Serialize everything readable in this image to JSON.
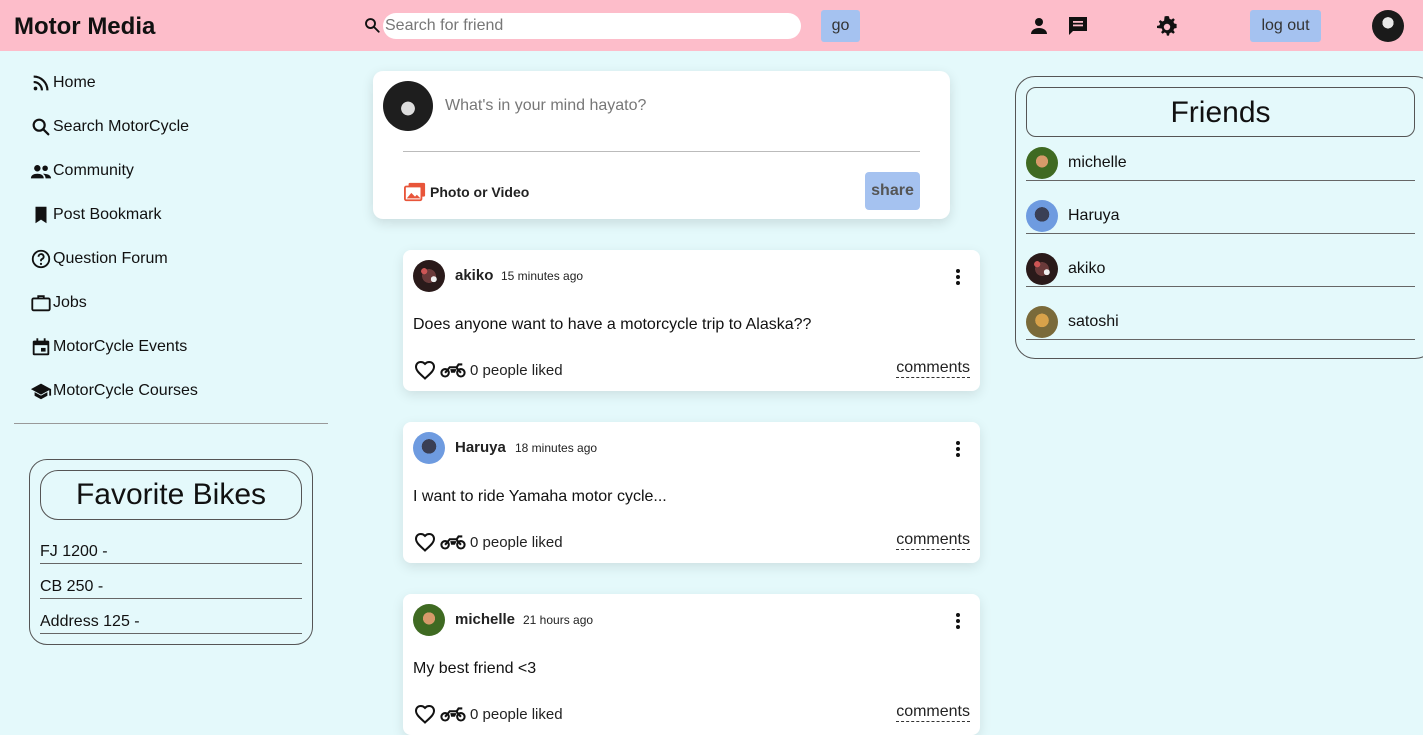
{
  "header": {
    "logo": "Motor Media",
    "search_placeholder": "Search for friend",
    "go_label": "go",
    "logout_label": "log out"
  },
  "sidebar": {
    "items": [
      {
        "label": "Home",
        "icon": "rss-icon"
      },
      {
        "label": "Search MotorCycle",
        "icon": "search-icon"
      },
      {
        "label": "Community",
        "icon": "people-icon"
      },
      {
        "label": "Post Bookmark",
        "icon": "bookmark-icon"
      },
      {
        "label": "Question Forum",
        "icon": "question-icon"
      },
      {
        "label": "Jobs",
        "icon": "briefcase-icon"
      },
      {
        "label": "MotorCycle Events",
        "icon": "calendar-icon"
      },
      {
        "label": "MotorCycle Courses",
        "icon": "graduation-cap-icon"
      }
    ],
    "favorites_title": "Favorite Bikes",
    "favorites": [
      "FJ 1200 -",
      "CB 250 -",
      "Address 125 -"
    ]
  },
  "share": {
    "placeholder": "What's in your mind hayato?",
    "photo_label": "Photo or Video",
    "share_label": "share"
  },
  "posts": [
    {
      "user": "akiko",
      "time": "15 minutes ago",
      "text": "Does anyone want to have a motorcycle trip to Alaska??",
      "likes": "0 people liked",
      "comments": "comments"
    },
    {
      "user": "Haruya",
      "time": "18 minutes ago",
      "text": "I want to ride Yamaha motor cycle...",
      "likes": "0 people liked",
      "comments": "comments"
    },
    {
      "user": "michelle",
      "time": "21 hours ago",
      "text": "My best friend <3",
      "likes": "0 people liked",
      "comments": "comments"
    }
  ],
  "friends": {
    "title": "Friends",
    "list": [
      "michelle",
      "Haruya",
      "akiko",
      "satoshi"
    ]
  },
  "colors": {
    "header_bg": "#fdbdca",
    "page_bg": "#e4f9fb",
    "button_bg": "#a5c2f0"
  }
}
